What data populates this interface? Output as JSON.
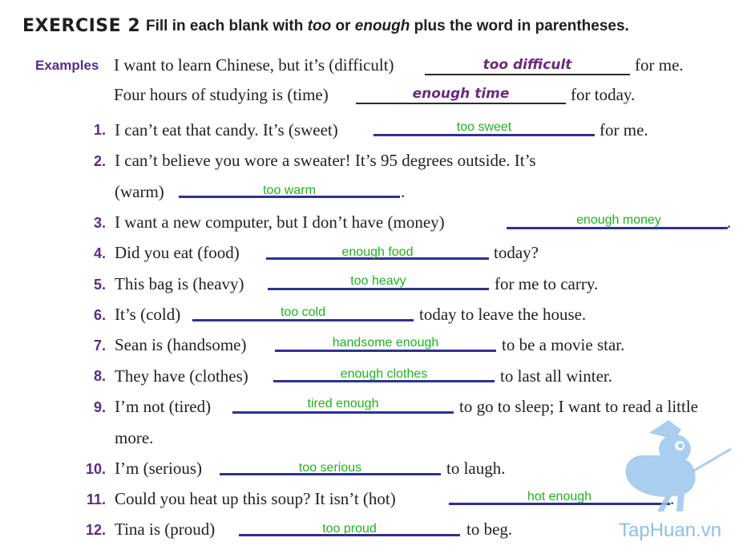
{
  "header": {
    "exercise": "EXERCISE 2",
    "instr_a": "Fill in each blank with ",
    "instr_too": "too",
    "instr_or": " or ",
    "instr_enough": "enough",
    "instr_b": " plus the word in parentheses."
  },
  "examples": {
    "label": "Examples",
    "e1_before": "I want to learn Chinese, but it’s (difficult)",
    "e1_answer": "too difficult",
    "e1_after": "for me.",
    "e2_before": "Four hours of studying is (time)",
    "e2_answer": "enough time",
    "e2_after": "for today."
  },
  "items": {
    "i1": {
      "num": "1.",
      "before": "I can’t eat that candy. It’s (sweet)",
      "answer": "too sweet",
      "after": "for me."
    },
    "i2": {
      "num": "2.",
      "before": "I can’t believe you wore a sweater! It’s 95 degrees outside. It’s",
      "before2": "(warm)",
      "answer": "too warm",
      "after": "."
    },
    "i3": {
      "num": "3.",
      "before": "I want a new computer, but I don’t have (money)",
      "answer": "enough money",
      "after": "."
    },
    "i4": {
      "num": "4.",
      "before": "Did you eat (food)",
      "answer": "enough food",
      "after": "today?"
    },
    "i5": {
      "num": "5.",
      "before": "This bag is (heavy)",
      "answer": "too heavy",
      "after": "for me to carry."
    },
    "i6": {
      "num": "6.",
      "before": "It’s (cold)",
      "answer": "too cold",
      "after": "today to leave the house."
    },
    "i7": {
      "num": "7.",
      "before": "Sean is (handsome)",
      "answer": "handsome enough",
      "after": "to be a movie star."
    },
    "i8": {
      "num": "8.",
      "before": "They have (clothes)",
      "answer": "enough clothes",
      "after": "to last all winter."
    },
    "i9": {
      "num": "9.",
      "before": "I’m not (tired)",
      "answer": "tired enough",
      "after": "to go to sleep; I want to read a little",
      "after2": "more."
    },
    "i10": {
      "num": "10.",
      "before": "I’m (serious)",
      "answer": "too serious",
      "after": "to laugh."
    },
    "i11": {
      "num": "11.",
      "before": "Could you heat up this soup? It isn’t (hot)",
      "answer": "hot enough",
      "after": "."
    },
    "i12": {
      "num": "12.",
      "before": "Tina is (proud)",
      "answer": "too proud",
      "after": "to beg."
    }
  },
  "watermark": {
    "text": "TapHuan.vn"
  }
}
